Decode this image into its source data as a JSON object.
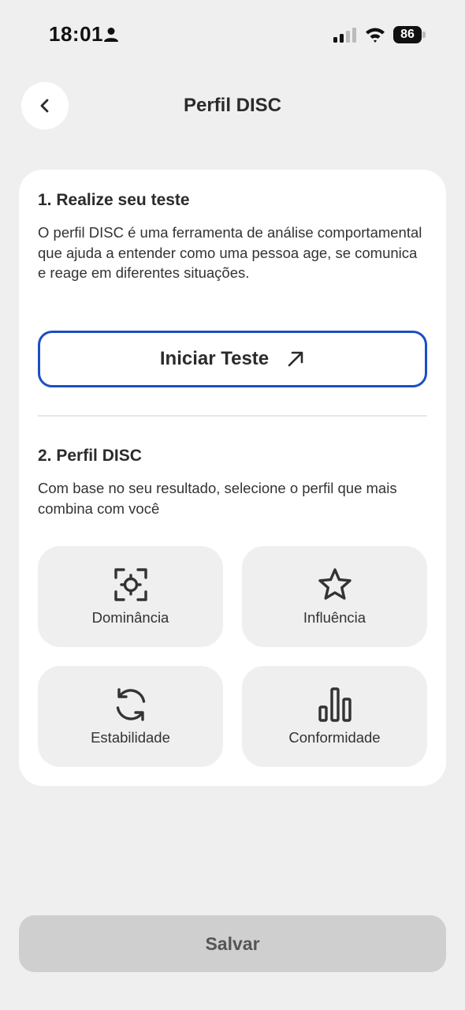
{
  "status_bar": {
    "time": "18:01",
    "battery": "86"
  },
  "header": {
    "title": "Perfil DISC",
    "back_icon": "chevron-left-icon"
  },
  "section1": {
    "title": "1. Realize seu teste",
    "description": "O perfil DISC é uma ferramenta de análise comportamental que ajuda a entender como uma pessoa age, se comunica e reage em diferentes situações.",
    "button_label": "Iniciar Teste",
    "button_icon": "arrow-up-right-icon",
    "accent_color": "#1a4fc4"
  },
  "section2": {
    "title": "2. Perfil DISC",
    "description": "Com base no seu resultado, selecione o perfil que mais combina com você",
    "options": [
      {
        "label": "Dominância",
        "icon": "focus-target-icon"
      },
      {
        "label": "Influência",
        "icon": "star-icon"
      },
      {
        "label": "Estabilidade",
        "icon": "refresh-icon"
      },
      {
        "label": "Conformidade",
        "icon": "bar-chart-icon"
      }
    ]
  },
  "footer": {
    "save_label": "Salvar"
  }
}
